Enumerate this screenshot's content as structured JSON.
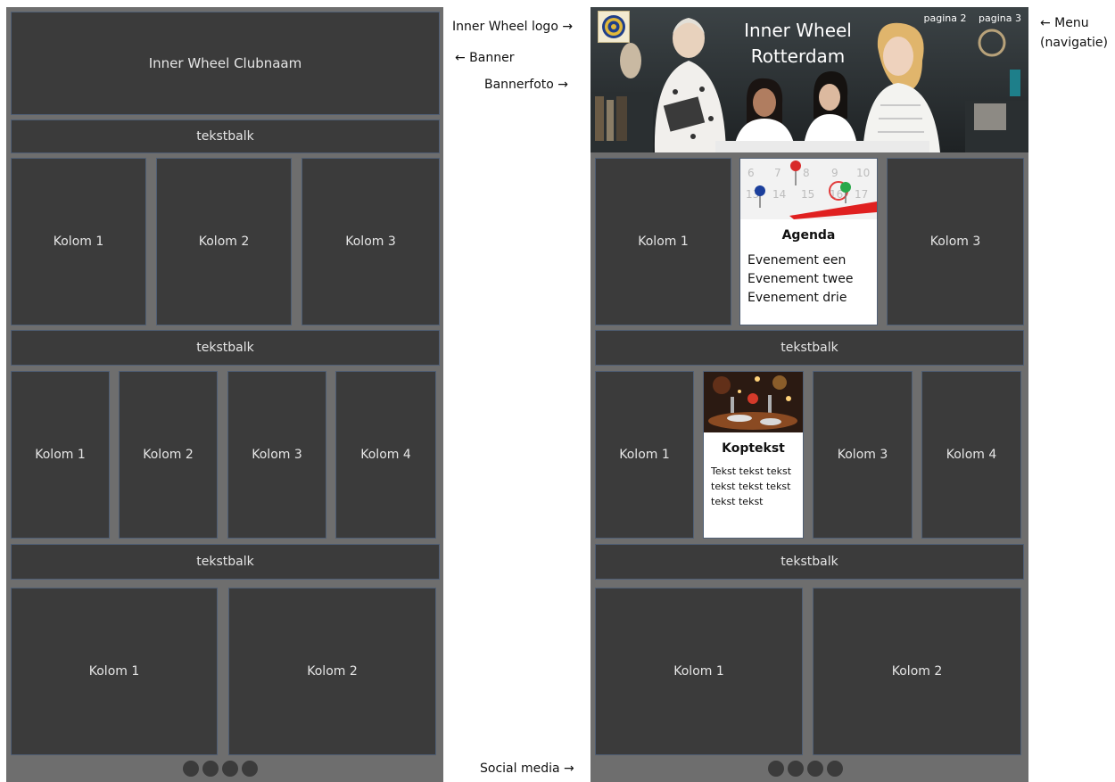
{
  "left": {
    "header": "Inner Wheel Clubnaam",
    "bar": "tekstbalk",
    "row1": [
      "Kolom 1",
      "Kolom 2",
      "Kolom 3"
    ],
    "row2": [
      "Kolom 1",
      "Kolom 2",
      "Kolom 3",
      "Kolom 4"
    ],
    "row3": [
      "Kolom 1",
      "Kolom 2"
    ]
  },
  "right": {
    "title_line1": "Inner Wheel",
    "title_line2": "Rotterdam",
    "menu": [
      "pagina 2",
      "pagina 3"
    ],
    "bar": "tekstbalk",
    "row1": [
      "Kolom 1",
      "Kolom 3"
    ],
    "agenda": {
      "title": "Agenda",
      "items": [
        "Evenement een",
        "Evenement twee",
        "Evenement drie"
      ]
    },
    "row2": [
      "Kolom 1",
      "Kolom 3",
      "Kolom 4"
    ],
    "news": {
      "title": "Koptekst",
      "lines": [
        "Tekst tekst tekst",
        "tekst tekst tekst",
        "tekst tekst"
      ]
    },
    "row3": [
      "Kolom 1",
      "Kolom 2"
    ]
  },
  "annotations": {
    "logo": "Inner Wheel logo →",
    "banner": "← Banner",
    "photo": "Bannerfoto →",
    "menu_line1": "← Menu",
    "menu_line2": "(navigatie)",
    "social": "Social media →"
  },
  "colors": {
    "frame": "#6e6e6e",
    "box": "#3b3b3b",
    "box_border": "#4f5e74",
    "box_text": "#e6e6e6"
  }
}
